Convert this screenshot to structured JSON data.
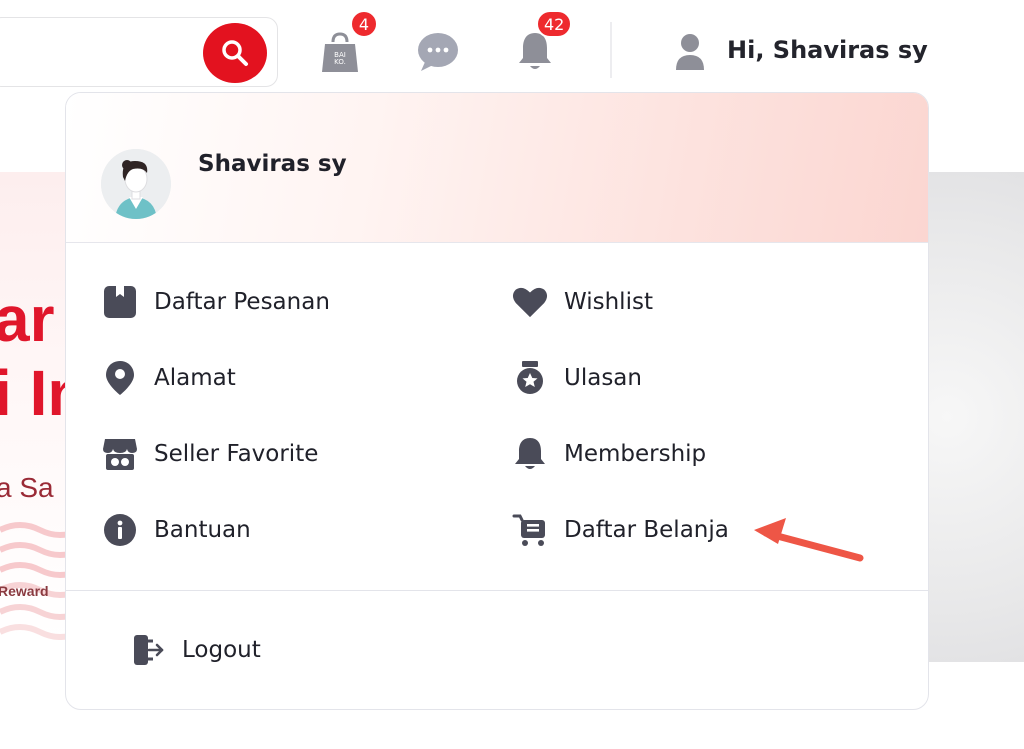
{
  "header": {
    "search_placeholder": "",
    "cart_badge": "4",
    "notif_badge": "42",
    "greeting": "Hi, Shaviras sy"
  },
  "background": {
    "line1": "ar",
    "line2": "i In",
    "sub": "a Sa",
    "reward": "Reward"
  },
  "dropdown": {
    "user_name": "Shaviras sy",
    "items": [
      {
        "label": "Daftar Pesanan",
        "icon": "order-box-icon"
      },
      {
        "label": "Wishlist",
        "icon": "heart-icon"
      },
      {
        "label": "Alamat",
        "icon": "location-pin-icon"
      },
      {
        "label": "Ulasan",
        "icon": "review-medal-icon"
      },
      {
        "label": "Seller Favorite",
        "icon": "store-icon"
      },
      {
        "label": "Membership",
        "icon": "bell-icon"
      },
      {
        "label": "Bantuan",
        "icon": "info-icon"
      },
      {
        "label": "Daftar Belanja",
        "icon": "shopping-list-cart-icon"
      }
    ],
    "logout_label": "Logout"
  },
  "colors": {
    "brand_red": "#e3121f",
    "badge_red": "#ee2a2e",
    "icon_dark": "#4a4b58",
    "annotation_arrow": "#ee5646"
  }
}
